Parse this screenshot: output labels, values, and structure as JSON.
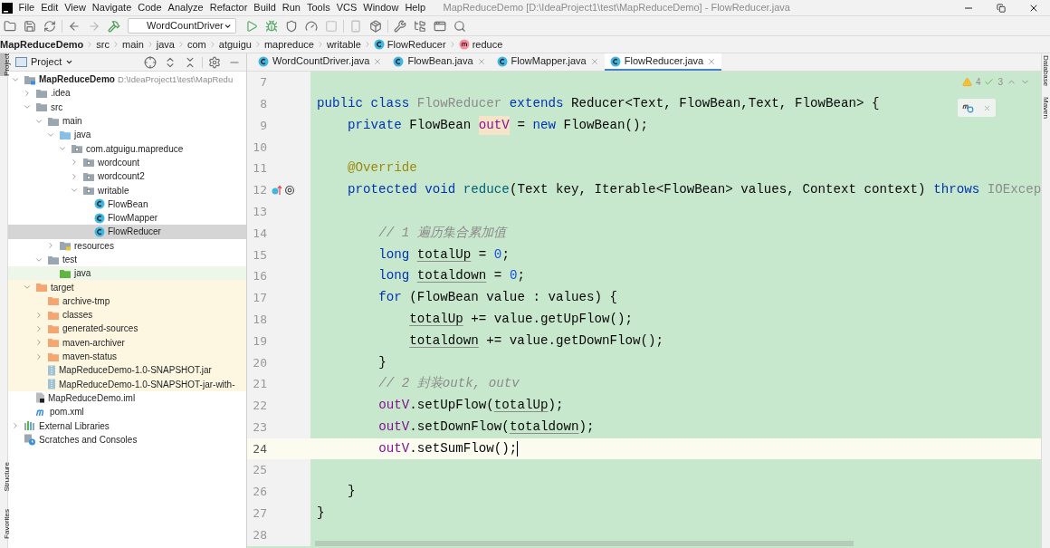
{
  "window": {
    "title": "MapReduceDemo [D:\\IdeaProject1\\test\\MapReduceDemo] - FlowReducer.java"
  },
  "menu": [
    "File",
    "Edit",
    "View",
    "Navigate",
    "Code",
    "Analyze",
    "Refactor",
    "Build",
    "Run",
    "Tools",
    "VCS",
    "Window",
    "Help"
  ],
  "toolbar": {
    "run_config": "WordCountDriver"
  },
  "breadcrumbs": [
    {
      "label": "MapReduceDemo",
      "kind": "project"
    },
    {
      "label": "src",
      "kind": "folder"
    },
    {
      "label": "main",
      "kind": "folder"
    },
    {
      "label": "java",
      "kind": "folder"
    },
    {
      "label": "com",
      "kind": "folder"
    },
    {
      "label": "atguigu",
      "kind": "folder"
    },
    {
      "label": "mapreduce",
      "kind": "folder"
    },
    {
      "label": "writable",
      "kind": "folder"
    },
    {
      "label": "FlowReducer",
      "kind": "class"
    },
    {
      "label": "reduce",
      "kind": "method"
    }
  ],
  "left_stripe": [
    {
      "label": "Project",
      "selected": true
    },
    {
      "label": "Structure",
      "selected": false
    },
    {
      "label": "Favorites",
      "selected": false
    }
  ],
  "right_stripe": [
    "Database",
    "Maven"
  ],
  "project_panel": {
    "title": "Project",
    "tree": [
      {
        "label": "MapReduceDemo",
        "path": "D:\\IdeaProject1\\test\\MapRedu",
        "kind": "module",
        "expanded": true,
        "selected": false,
        "children": [
          {
            "label": ".idea",
            "kind": "folder",
            "expanded": false,
            "selected": false
          },
          {
            "label": "src",
            "kind": "folder",
            "expanded": true,
            "selected": false,
            "children": [
              {
                "label": "main",
                "kind": "folder",
                "expanded": true,
                "selected": false,
                "children": [
                  {
                    "label": "java",
                    "kind": "source-root",
                    "expanded": true,
                    "selected": false,
                    "children": [
                      {
                        "label": "com.atguigu.mapreduce",
                        "kind": "package",
                        "expanded": true,
                        "selected": false,
                        "children": [
                          {
                            "label": "wordcount",
                            "kind": "package",
                            "expanded": false,
                            "selected": false
                          },
                          {
                            "label": "wordcount2",
                            "kind": "package",
                            "expanded": false,
                            "selected": false
                          },
                          {
                            "label": "writable",
                            "kind": "package",
                            "expanded": true,
                            "selected": false,
                            "children": [
                              {
                                "label": "FlowBean",
                                "kind": "class",
                                "selected": false
                              },
                              {
                                "label": "FlowMapper",
                                "kind": "class",
                                "selected": false
                              },
                              {
                                "label": "FlowReducer",
                                "kind": "class",
                                "selected": true
                              }
                            ]
                          }
                        ]
                      }
                    ]
                  },
                  {
                    "label": "resources",
                    "kind": "resources-root",
                    "expanded": false,
                    "selected": false
                  }
                ]
              },
              {
                "label": "test",
                "kind": "folder",
                "expanded": true,
                "selected": false,
                "children": [
                  {
                    "label": "java",
                    "kind": "test-root",
                    "selected": false
                  }
                ]
              }
            ]
          },
          {
            "label": "target",
            "kind": "excluded-folder",
            "expanded": true,
            "selected": false,
            "children": [
              {
                "label": "archive-tmp",
                "kind": "excluded-folder",
                "selected": false
              },
              {
                "label": "classes",
                "kind": "excluded-folder",
                "expanded": false,
                "selected": false
              },
              {
                "label": "generated-sources",
                "kind": "excluded-folder",
                "expanded": false,
                "selected": false
              },
              {
                "label": "maven-archiver",
                "kind": "excluded-folder",
                "expanded": false,
                "selected": false
              },
              {
                "label": "maven-status",
                "kind": "excluded-folder",
                "expanded": false,
                "selected": false
              },
              {
                "label": "MapReduceDemo-1.0-SNAPSHOT.jar",
                "kind": "jar",
                "selected": false
              },
              {
                "label": "MapReduceDemo-1.0-SNAPSHOT-jar-with-",
                "kind": "jar",
                "selected": false
              }
            ]
          },
          {
            "label": "MapReduceDemo.iml",
            "kind": "iml",
            "selected": false
          },
          {
            "label": "pom.xml",
            "kind": "maven",
            "selected": false
          }
        ]
      },
      {
        "label": "External Libraries",
        "kind": "libraries",
        "expanded": false,
        "selected": false
      },
      {
        "label": "Scratches and Consoles",
        "kind": "scratches",
        "selected": false
      }
    ]
  },
  "tabs": [
    {
      "label": "WordCountDriver.java",
      "selected": false
    },
    {
      "label": "FlowBean.java",
      "selected": false
    },
    {
      "label": "FlowMapper.java",
      "selected": false
    },
    {
      "label": "FlowReducer.java",
      "selected": true
    }
  ],
  "inspections": {
    "warnings": "4",
    "weak_warnings": "3"
  },
  "editor_lines": [
    {
      "number": "7",
      "current": false
    },
    {
      "number": "8",
      "current": false,
      "tokens": [
        {
          "kind": "keyword",
          "text": "public class "
        },
        {
          "kind": "unused",
          "text": "FlowReducer "
        },
        {
          "kind": "keyword",
          "text": "extends "
        },
        {
          "kind": "plain",
          "text": "Reducer<Text, FlowBean,Text, FlowBean> {"
        }
      ]
    },
    {
      "number": "9",
      "current": false,
      "tokens": [
        {
          "kind": "keyword",
          "text": "    private "
        },
        {
          "kind": "plain",
          "text": "FlowBean "
        },
        {
          "kind": "field-highlight",
          "text": "outV"
        },
        {
          "kind": "plain",
          "text": " = "
        },
        {
          "kind": "keyword",
          "text": "new "
        },
        {
          "kind": "plain",
          "text": "FlowBean();"
        }
      ]
    },
    {
      "number": "10",
      "current": false
    },
    {
      "number": "11",
      "current": false,
      "tokens": [
        {
          "kind": "annotation",
          "text": "    @Override"
        }
      ]
    },
    {
      "number": "12",
      "current": false,
      "gutter_marks": true,
      "tokens": [
        {
          "kind": "keyword",
          "text": "    protected void "
        },
        {
          "kind": "method",
          "text": "reduce"
        },
        {
          "kind": "plain",
          "text": "(Text key, Iterable<FlowBean> values, Context context) "
        },
        {
          "kind": "keyword",
          "text": "throws "
        },
        {
          "kind": "unused",
          "text": "IOExcep"
        }
      ]
    },
    {
      "number": "13",
      "current": false
    },
    {
      "number": "14",
      "current": false,
      "tokens": [
        {
          "kind": "comment",
          "text": "        // 1 遍历集合累加值"
        }
      ]
    },
    {
      "number": "15",
      "current": false,
      "tokens": [
        {
          "kind": "keyword",
          "text": "        long "
        },
        {
          "kind": "reassigned",
          "text": "totalUp"
        },
        {
          "kind": "plain",
          "text": " = "
        },
        {
          "kind": "number",
          "text": "0"
        },
        {
          "kind": "plain",
          "text": ";"
        }
      ]
    },
    {
      "number": "16",
      "current": false,
      "tokens": [
        {
          "kind": "keyword",
          "text": "        long "
        },
        {
          "kind": "reassigned",
          "text": "totaldown"
        },
        {
          "kind": "plain",
          "text": " = "
        },
        {
          "kind": "number",
          "text": "0"
        },
        {
          "kind": "plain",
          "text": ";"
        }
      ]
    },
    {
      "number": "17",
      "current": false,
      "tokens": [
        {
          "kind": "keyword",
          "text": "        for "
        },
        {
          "kind": "plain",
          "text": "(FlowBean value : values) {"
        }
      ]
    },
    {
      "number": "18",
      "current": false,
      "tokens": [
        {
          "kind": "reassigned",
          "text": "            totalUp"
        },
        {
          "kind": "plain",
          "text": " += value.getUpFlow();"
        }
      ]
    },
    {
      "number": "19",
      "current": false,
      "tokens": [
        {
          "kind": "reassigned",
          "text": "            totaldown"
        },
        {
          "kind": "plain",
          "text": " += value.getDownFlow();"
        }
      ]
    },
    {
      "number": "20",
      "current": false,
      "tokens": [
        {
          "kind": "plain",
          "text": "        }"
        }
      ]
    },
    {
      "number": "21",
      "current": false,
      "tokens": [
        {
          "kind": "comment",
          "text": "        // 2 封装outk, outv"
        }
      ]
    },
    {
      "number": "22",
      "current": false,
      "tokens": [
        {
          "kind": "field",
          "text": "        outV"
        },
        {
          "kind": "plain",
          "text": ".setUpFlow("
        },
        {
          "kind": "reassigned",
          "text": "totalUp"
        },
        {
          "kind": "plain",
          "text": ");"
        }
      ]
    },
    {
      "number": "23",
      "current": false,
      "tokens": [
        {
          "kind": "field",
          "text": "        outV"
        },
        {
          "kind": "plain",
          "text": ".setDownFlow("
        },
        {
          "kind": "reassigned",
          "text": "totaldown"
        },
        {
          "kind": "plain",
          "text": ");"
        }
      ]
    },
    {
      "number": "24",
      "current": true,
      "tokens": [
        {
          "kind": "field",
          "text": "        outV"
        },
        {
          "kind": "plain",
          "text": ".setSumFlow();"
        }
      ]
    },
    {
      "number": "25",
      "current": false
    },
    {
      "number": "26",
      "current": false,
      "tokens": [
        {
          "kind": "plain",
          "text": "    }"
        }
      ]
    },
    {
      "number": "27",
      "current": false,
      "tokens": [
        {
          "kind": "plain",
          "text": "}"
        }
      ]
    },
    {
      "number": "28",
      "current": false
    }
  ]
}
